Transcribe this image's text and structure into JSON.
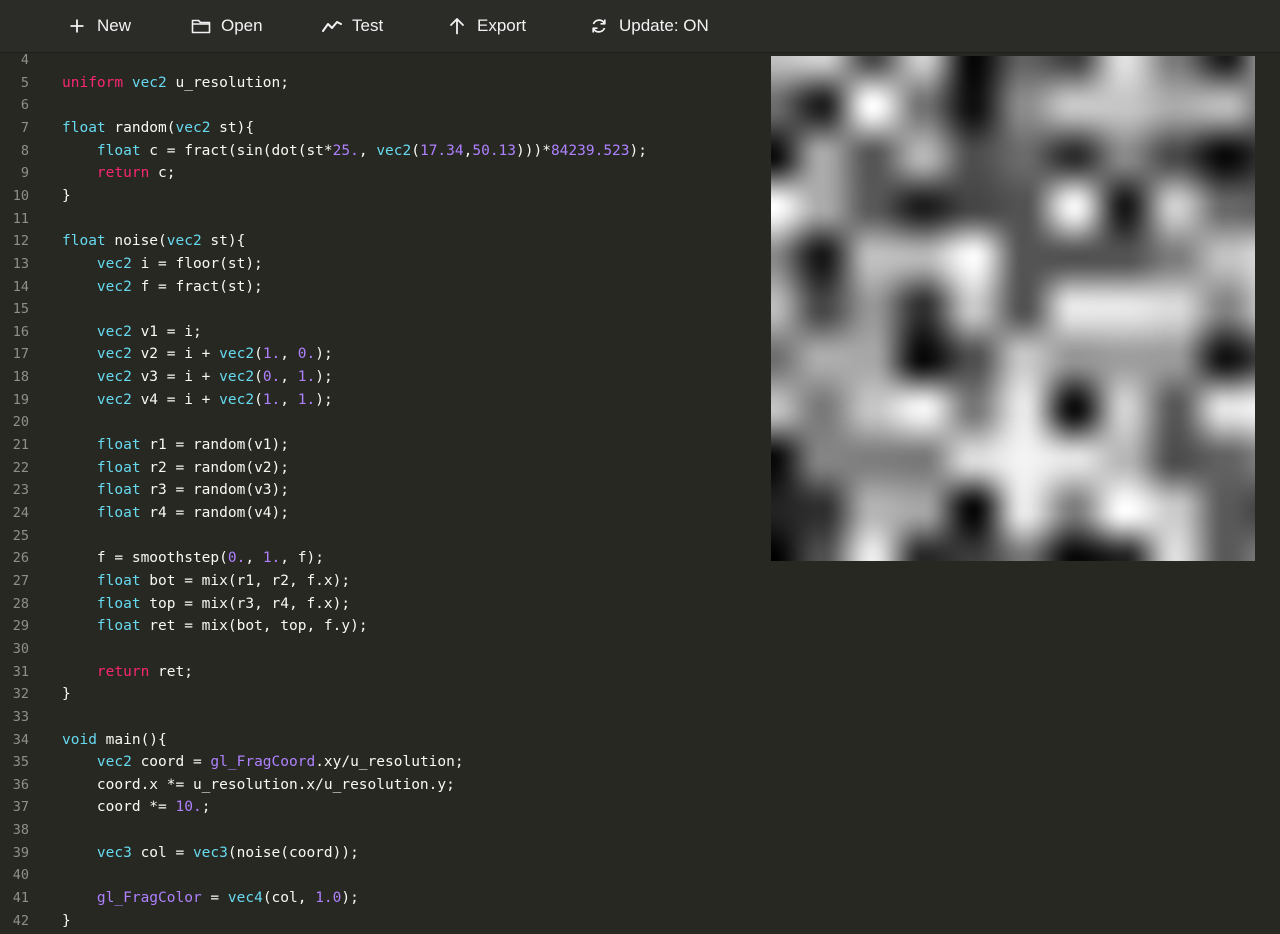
{
  "toolbar": {
    "buttons": [
      {
        "label": "New",
        "icon": "plus-icon"
      },
      {
        "label": "Open",
        "icon": "folder-icon"
      },
      {
        "label": "Test",
        "icon": "chart-line-icon"
      },
      {
        "label": "Export",
        "icon": "arrow-up-icon"
      },
      {
        "label": "Update: ON",
        "icon": "refresh-icon"
      }
    ]
  },
  "colors": {
    "background": "#272822",
    "toolbar": "#2b2b28",
    "keyword": "#f92672",
    "type": "#66d9ef",
    "number": "#ae81ff",
    "text": "#f8f8f2",
    "line_number": "#8f908a"
  },
  "editor": {
    "first_line_number": 4,
    "lines": [
      [],
      [
        [
          "kw",
          "uniform"
        ],
        [
          "t",
          " "
        ],
        [
          "ty",
          "vec2"
        ],
        [
          "t",
          " u_resolution;"
        ]
      ],
      [],
      [
        [
          "ty",
          "float"
        ],
        [
          "t",
          " random("
        ],
        [
          "ty",
          "vec2"
        ],
        [
          "t",
          " st){"
        ]
      ],
      [
        [
          "t",
          "    "
        ],
        [
          "ty",
          "float"
        ],
        [
          "t",
          " c = fract(sin(dot(st*"
        ],
        [
          "num",
          "25."
        ],
        [
          "t",
          ", "
        ],
        [
          "ty",
          "vec2"
        ],
        [
          "t",
          "("
        ],
        [
          "num",
          "17.34"
        ],
        [
          "t",
          ","
        ],
        [
          "num",
          "50.13"
        ],
        [
          "t",
          ")))*"
        ],
        [
          "num",
          "84239.523"
        ],
        [
          "t",
          ");"
        ]
      ],
      [
        [
          "t",
          "    "
        ],
        [
          "kw",
          "return"
        ],
        [
          "t",
          " c;"
        ]
      ],
      [
        [
          "t",
          "}"
        ]
      ],
      [],
      [
        [
          "ty",
          "float"
        ],
        [
          "t",
          " noise("
        ],
        [
          "ty",
          "vec2"
        ],
        [
          "t",
          " st){"
        ]
      ],
      [
        [
          "t",
          "    "
        ],
        [
          "ty",
          "vec2"
        ],
        [
          "t",
          " i = floor(st);"
        ]
      ],
      [
        [
          "t",
          "    "
        ],
        [
          "ty",
          "vec2"
        ],
        [
          "t",
          " f = fract(st);"
        ]
      ],
      [],
      [
        [
          "t",
          "    "
        ],
        [
          "ty",
          "vec2"
        ],
        [
          "t",
          " v1 = i;"
        ]
      ],
      [
        [
          "t",
          "    "
        ],
        [
          "ty",
          "vec2"
        ],
        [
          "t",
          " v2 = i + "
        ],
        [
          "ty",
          "vec2"
        ],
        [
          "t",
          "("
        ],
        [
          "num",
          "1."
        ],
        [
          "t",
          ", "
        ],
        [
          "num",
          "0."
        ],
        [
          "t",
          ");"
        ]
      ],
      [
        [
          "t",
          "    "
        ],
        [
          "ty",
          "vec2"
        ],
        [
          "t",
          " v3 = i + "
        ],
        [
          "ty",
          "vec2"
        ],
        [
          "t",
          "("
        ],
        [
          "num",
          "0."
        ],
        [
          "t",
          ", "
        ],
        [
          "num",
          "1."
        ],
        [
          "t",
          ");"
        ]
      ],
      [
        [
          "t",
          "    "
        ],
        [
          "ty",
          "vec2"
        ],
        [
          "t",
          " v4 = i + "
        ],
        [
          "ty",
          "vec2"
        ],
        [
          "t",
          "("
        ],
        [
          "num",
          "1."
        ],
        [
          "t",
          ", "
        ],
        [
          "num",
          "1."
        ],
        [
          "t",
          ");"
        ]
      ],
      [],
      [
        [
          "t",
          "    "
        ],
        [
          "ty",
          "float"
        ],
        [
          "t",
          " r1 = random(v1);"
        ]
      ],
      [
        [
          "t",
          "    "
        ],
        [
          "ty",
          "float"
        ],
        [
          "t",
          " r2 = random(v2);"
        ]
      ],
      [
        [
          "t",
          "    "
        ],
        [
          "ty",
          "float"
        ],
        [
          "t",
          " r3 = random(v3);"
        ]
      ],
      [
        [
          "t",
          "    "
        ],
        [
          "ty",
          "float"
        ],
        [
          "t",
          " r4 = random(v4);"
        ]
      ],
      [],
      [
        [
          "t",
          "    f = smoothstep("
        ],
        [
          "num",
          "0."
        ],
        [
          "t",
          ", "
        ],
        [
          "num",
          "1."
        ],
        [
          "t",
          ", f);"
        ]
      ],
      [
        [
          "t",
          "    "
        ],
        [
          "ty",
          "float"
        ],
        [
          "t",
          " bot = mix(r1, r2, f.x);"
        ]
      ],
      [
        [
          "t",
          "    "
        ],
        [
          "ty",
          "float"
        ],
        [
          "t",
          " top = mix(r3, r4, f.x);"
        ]
      ],
      [
        [
          "t",
          "    "
        ],
        [
          "ty",
          "float"
        ],
        [
          "t",
          " ret = mix(bot, top, f.y);"
        ]
      ],
      [],
      [
        [
          "t",
          "    "
        ],
        [
          "kw",
          "return"
        ],
        [
          "t",
          " ret;"
        ]
      ],
      [
        [
          "t",
          "}"
        ]
      ],
      [],
      [
        [
          "ty",
          "void"
        ],
        [
          "t",
          " main(){"
        ]
      ],
      [
        [
          "t",
          "    "
        ],
        [
          "ty",
          "vec2"
        ],
        [
          "t",
          " coord = "
        ],
        [
          "bi",
          "gl_FragCoord"
        ],
        [
          "t",
          ".xy/u_resolution;"
        ]
      ],
      [
        [
          "t",
          "    coord.x *= u_resolution.x/u_resolution.y;"
        ]
      ],
      [
        [
          "t",
          "    coord *= "
        ],
        [
          "num",
          "10."
        ],
        [
          "t",
          ";"
        ]
      ],
      [],
      [
        [
          "t",
          "    "
        ],
        [
          "ty",
          "vec3"
        ],
        [
          "t",
          " col = "
        ],
        [
          "ty",
          "vec3"
        ],
        [
          "t",
          "(noise(coord));"
        ]
      ],
      [],
      [
        [
          "t",
          "    "
        ],
        [
          "bi",
          "gl_FragColor"
        ],
        [
          "t",
          " = "
        ],
        [
          "ty",
          "vec4"
        ],
        [
          "t",
          "(col, "
        ],
        [
          "num",
          "1.0"
        ],
        [
          "t",
          ");"
        ]
      ],
      [
        [
          "t",
          "}"
        ]
      ]
    ]
  },
  "preview": {
    "grid_scale": 10.0,
    "hash_multiplier": 84239.523,
    "hash_vector": [
      17.34,
      50.13
    ],
    "seed_scale": 25.0
  }
}
